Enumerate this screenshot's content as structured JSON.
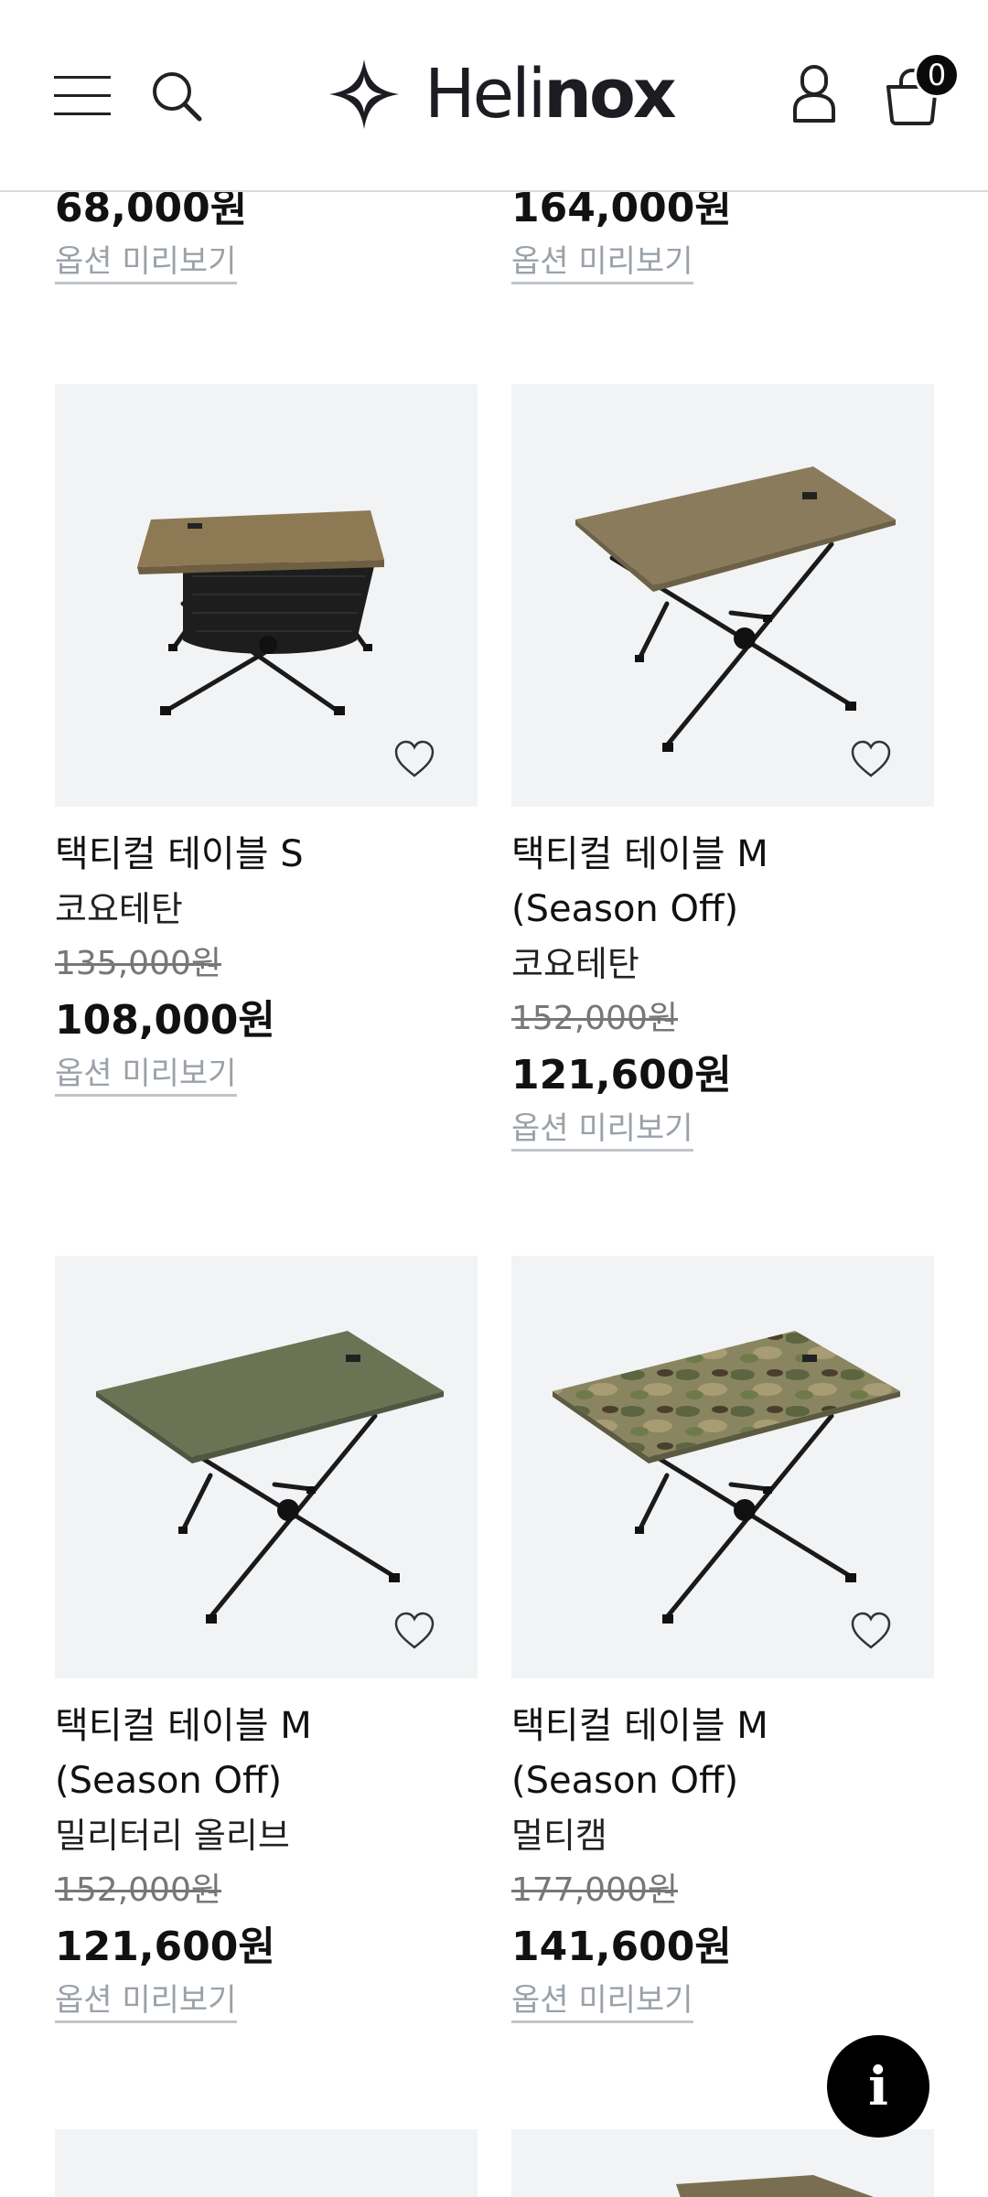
{
  "header": {
    "brand": "Helinox",
    "cart_count": "0"
  },
  "top_row": [
    {
      "price": "68,000원",
      "preview": "옵션 미리보기"
    },
    {
      "price": "164,000원",
      "preview": "옵션 미리보기"
    }
  ],
  "products": [
    {
      "name_line1": "택티컬 테이블 S",
      "name_line2": "",
      "color": "코요테탄",
      "original_price": "135,000원",
      "price": "108,000원",
      "preview": "옵션 미리보기",
      "top_color": "#8d7a55",
      "variant": "small"
    },
    {
      "name_line1": "택티컬 테이블 M",
      "name_line2": "(Season Off)",
      "color": "코요테탄",
      "original_price": "152,000원",
      "price": "121,600원",
      "preview": "옵션 미리보기",
      "top_color": "#8a7b5c",
      "variant": "medium"
    },
    {
      "name_line1": "택티컬 테이블 M",
      "name_line2": "(Season Off)",
      "color": "밀리터리 올리브",
      "original_price": "152,000원",
      "price": "121,600원",
      "preview": "옵션 미리보기",
      "top_color": "#6b7355",
      "variant": "medium"
    },
    {
      "name_line1": "택티컬 테이블 M",
      "name_line2": "(Season Off)",
      "color": "멀티캠",
      "original_price": "177,000원",
      "price": "141,600원",
      "preview": "옵션 미리보기",
      "top_color": "#7d7a58",
      "variant": "camo"
    }
  ],
  "info_button": "i"
}
